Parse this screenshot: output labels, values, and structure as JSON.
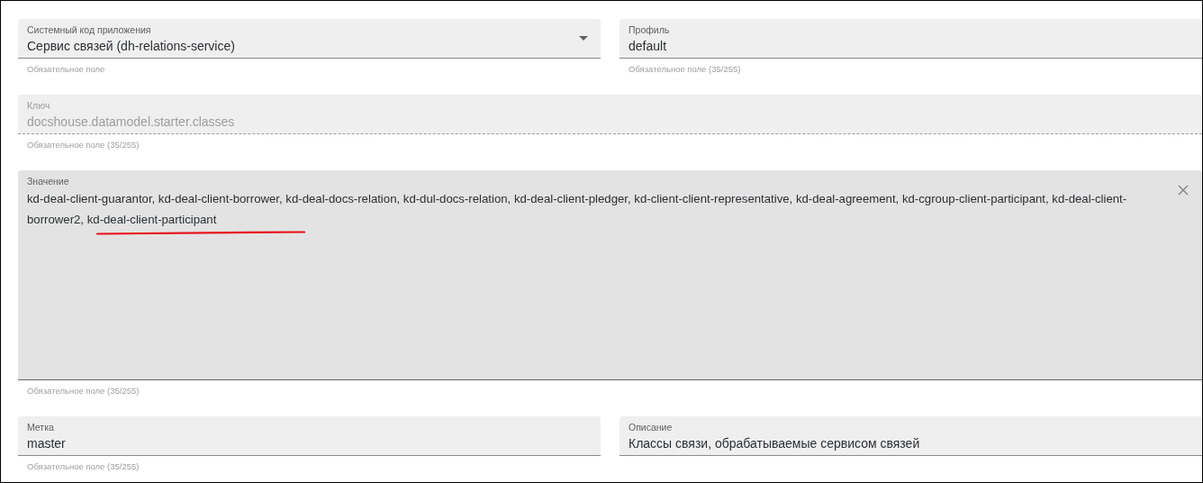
{
  "rows": [
    {
      "fields": [
        {
          "kind": "select",
          "label": "Системный код приложения",
          "value": "Сервис связей (dh-relations-service)",
          "hint": "Обязательное поле",
          "disabled": false
        },
        {
          "kind": "text",
          "label": "Профиль",
          "value": "default",
          "hint": "Обязательное поле (35/255)",
          "disabled": false
        }
      ]
    },
    {
      "fields": [
        {
          "kind": "text",
          "label": "Ключ",
          "value": "docshouse.datamodel.starter.classes",
          "hint": "Обязательное поле (35/255)",
          "disabled": true
        }
      ]
    },
    {
      "fields": [
        {
          "kind": "textarea",
          "label": "Значение",
          "value": "kd-deal-client-guarantor, kd-deal-client-borrower, kd-deal-docs-relation, kd-dul-docs-relation, kd-deal-client-pledger, kd-client-client-representative, kd-deal-agreement, kd-cgroup-client-participant, kd-deal-client-borrower2, kd-deal-client-participant",
          "hint": "Обязательное поле (35/255)",
          "disabled": false
        }
      ]
    },
    {
      "fields": [
        {
          "kind": "text",
          "label": "Метка",
          "value": "master",
          "hint": "Обязательное поле (35/255)",
          "disabled": false
        },
        {
          "kind": "text",
          "label": "Описание",
          "value": "Классы связи, обрабатываемые сервисом связей",
          "disabled": false
        }
      ]
    }
  ]
}
